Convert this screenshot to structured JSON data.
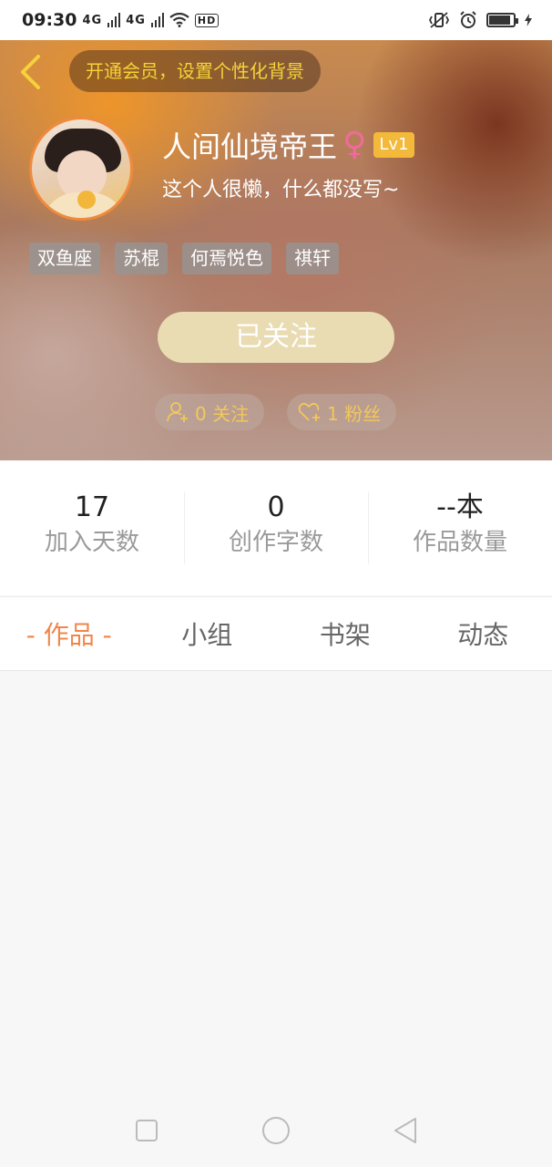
{
  "status_bar": {
    "time": "09:30",
    "signal1": "4G",
    "signal2": "4G",
    "hd": "HD",
    "battery_level": 0.9
  },
  "header": {
    "vip_banner": "开通会员，设置个性化背景",
    "username": "人间仙境帝王",
    "gender_symbol": "♀",
    "level": "Lv1",
    "bio": "这个人很懒，什么都没写~",
    "tags": [
      "双鱼座",
      "苏棍",
      "何焉悦色",
      "祺轩"
    ],
    "follow_button": "已关注",
    "following_text": "0 关注",
    "fans_text": "1 粉丝"
  },
  "stats": [
    {
      "value": "17",
      "label": "加入天数"
    },
    {
      "value": "0",
      "label": "创作字数"
    },
    {
      "value": "--本",
      "label": "作品数量"
    }
  ],
  "tabs": [
    "- 作品 -",
    "小组",
    "书架",
    "动态"
  ],
  "colors": {
    "accent": "#f0874a",
    "vip_text": "#f5d23a",
    "gender": "#f06a9a",
    "level_badge": "#f2b93a",
    "follow_button": "#e9dbb2"
  }
}
